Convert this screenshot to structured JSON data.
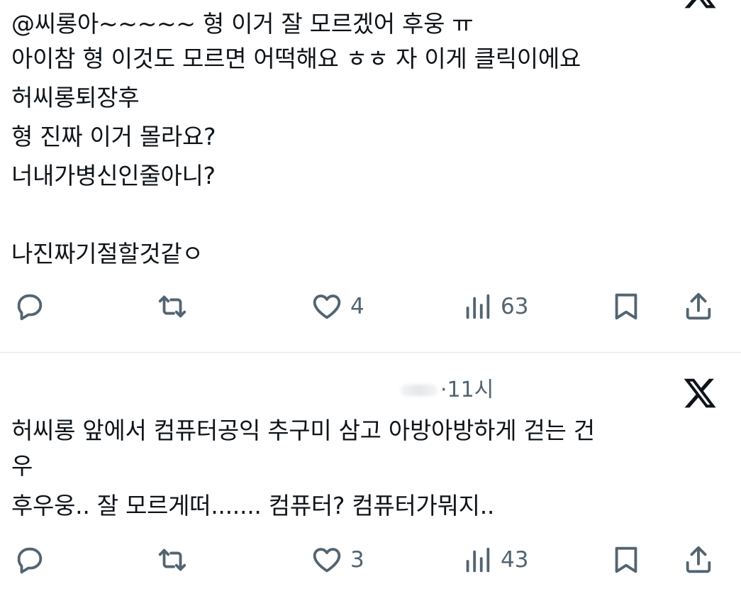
{
  "tweets": [
    {
      "lines": [
        "@씨롱아~~~~~ 형 이거 잘 모르겠어 후웅 ㅠ",
        "아이참 형 이것도 모르면 어떡해요 ㅎㅎ 자 이게 클릭이에요",
        "허씨롱퇴장후",
        "형 진짜 이거 몰라요?",
        "너내가병신인줄아니?",
        "",
        "나진짜기절할것같ㅇ"
      ],
      "actions": {
        "likes": "4",
        "views": "63"
      }
    },
    {
      "meta": {
        "dot": "·",
        "time": "11시"
      },
      "lines": [
        "허씨롱 앞에서 컴퓨터공익 추구미 삼고 아방아방하게 걷는 건",
        "우",
        "후우웅.. 잘 모르게떠....... 컴퓨터? 컴퓨터가뭐지.."
      ],
      "actions": {
        "likes": "3",
        "views": "43"
      }
    }
  ],
  "icons": [
    "x-logo-icon",
    "reply-icon",
    "retweet-icon",
    "like-icon",
    "views-icon",
    "bookmark-icon",
    "share-icon"
  ],
  "colors": {
    "text": "#0f1419",
    "muted": "#536471",
    "divider": "#dfe3e6"
  }
}
